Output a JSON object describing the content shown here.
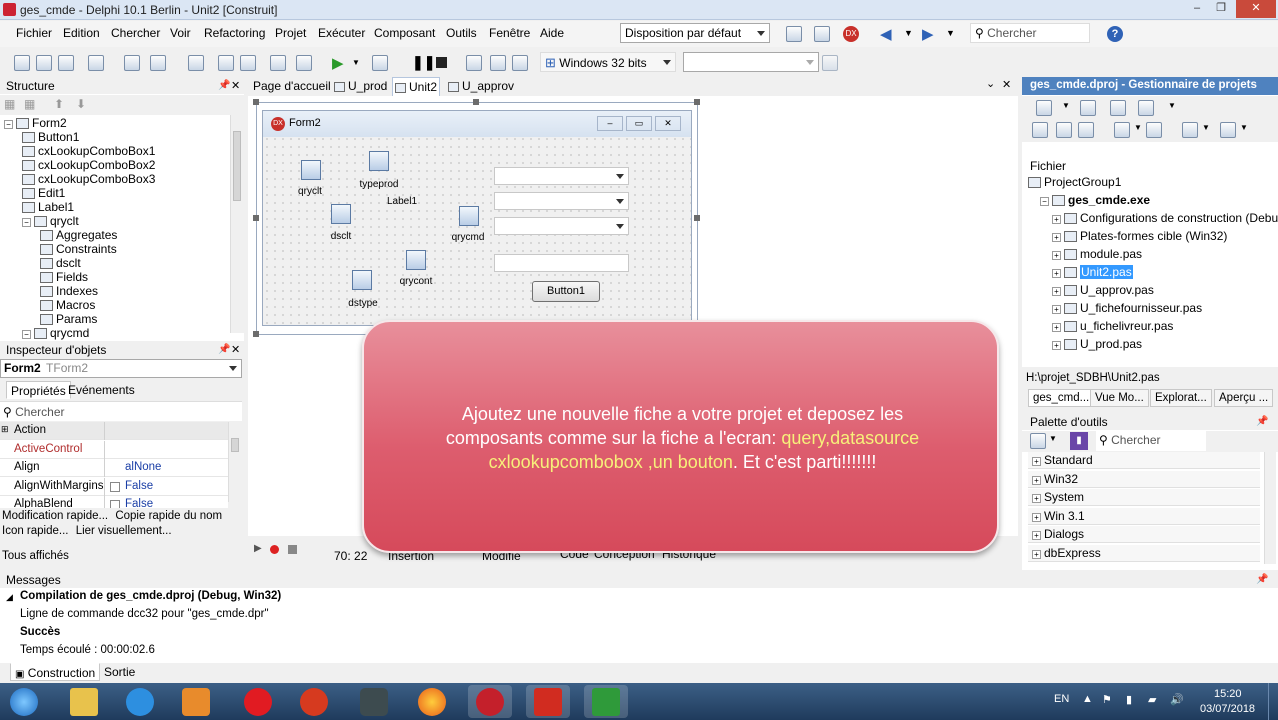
{
  "window": {
    "title": "ges_cmde - Delphi 10.1 Berlin - Unit2 [Construit]"
  },
  "menu": [
    "Fichier",
    "Edition",
    "Chercher",
    "Voir",
    "Refactoring",
    "Projet",
    "Exécuter",
    "Composant",
    "Outils",
    "Fenêtre",
    "Aide"
  ],
  "toolbar": {
    "layout_combo": "Disposition par défaut",
    "search_placeholder": "Chercher",
    "platform_combo": "Windows 32 bits",
    "config_combo": ""
  },
  "structure": {
    "title": "Structure",
    "items": [
      {
        "label": "Form2",
        "level": 0
      },
      {
        "label": "Button1",
        "level": 1
      },
      {
        "label": "cxLookupComboBox1",
        "level": 1
      },
      {
        "label": "cxLookupComboBox2",
        "level": 1
      },
      {
        "label": "cxLookupComboBox3",
        "level": 1
      },
      {
        "label": "Edit1",
        "level": 1
      },
      {
        "label": "Label1",
        "level": 1
      },
      {
        "label": "qryclt",
        "level": 1
      },
      {
        "label": "Aggregates",
        "level": 2
      },
      {
        "label": "Constraints",
        "level": 2
      },
      {
        "label": "dsclt",
        "level": 2
      },
      {
        "label": "Fields",
        "level": 2
      },
      {
        "label": "Indexes",
        "level": 2
      },
      {
        "label": "Macros",
        "level": 2
      },
      {
        "label": "Params",
        "level": 2
      },
      {
        "label": "qrycmd",
        "level": 1
      }
    ]
  },
  "inspector": {
    "title": "Inspecteur d'objets",
    "object": "Form2",
    "object_type": "TForm2",
    "tabs": [
      "Propriétés",
      "Evénements"
    ],
    "search_placeholder": "Chercher",
    "rows": [
      {
        "name": "Action",
        "value": ""
      },
      {
        "name": "ActiveControl",
        "value": ""
      },
      {
        "name": "Align",
        "value": "alNone"
      },
      {
        "name": "AlignWithMargins",
        "value": "False"
      },
      {
        "name": "AlphaBlend",
        "value": "False"
      }
    ],
    "hints": [
      [
        "Modification rapide...",
        "Copie rapide du nom"
      ],
      [
        "Icon rapide...",
        "Lier visuellement..."
      ]
    ],
    "filter": "Tous affichés"
  },
  "editor": {
    "tabs": [
      "Page d'accueil",
      "U_prod",
      "Unit2",
      "U_approv"
    ],
    "active_tab": "Unit2",
    "form": {
      "caption": "Form2",
      "components": [
        "qryclt",
        "typeprod",
        "dsclt",
        "qrycmd",
        "qrycont",
        "dstype"
      ],
      "label": "Label1",
      "button": "Button1"
    },
    "status": {
      "position": "70: 22",
      "mode": "Insertion",
      "modified": "Modifié",
      "tabs": [
        "Code",
        "Conception",
        "Historique"
      ]
    }
  },
  "project": {
    "title": "ges_cmde.dproj - Gestionnaire de projets",
    "files_label": "Fichier",
    "tree": [
      {
        "label": "ProjectGroup1",
        "level": 0,
        "bold": false
      },
      {
        "label": "ges_cmde.exe",
        "level": 1,
        "bold": true
      },
      {
        "label": "Configurations de construction (Debug)",
        "level": 2,
        "bold": false
      },
      {
        "label": "Plates-formes cible (Win32)",
        "level": 2,
        "bold": false
      },
      {
        "label": "module.pas",
        "level": 2,
        "bold": false
      },
      {
        "label": "Unit2.pas",
        "level": 2,
        "bold": false,
        "selected": true
      },
      {
        "label": "U_approv.pas",
        "level": 2,
        "bold": false
      },
      {
        "label": "U_fichefournisseur.pas",
        "level": 2,
        "bold": false
      },
      {
        "label": "u_fichelivreur.pas",
        "level": 2,
        "bold": false
      },
      {
        "label": "U_prod.pas",
        "level": 2,
        "bold": false
      }
    ],
    "path": "H:\\projet_SDBH\\Unit2.pas",
    "tabs": [
      "ges_cmd...",
      "Vue Mo...",
      "Explorat...",
      "Aperçu ..."
    ]
  },
  "palette": {
    "title": "Palette d'outils",
    "search_placeholder": "Chercher",
    "groups": [
      "Standard",
      "Win32",
      "System",
      "Win 3.1",
      "Dialogs",
      "dbExpress"
    ]
  },
  "overlay": {
    "line1": "Ajoutez une nouvelle fiche a votre projet et deposez les",
    "line2_a": "composants comme sur la fiche a l'ecran: ",
    "line2_b": "query,datasource",
    "line3_a": "cxlookupcombobox ,un bouton",
    "line3_b": ". Et c'est parti!!!!!!!"
  },
  "messages": {
    "title": "Messages",
    "lines": [
      {
        "text": "Compilation de ges_cmde.dproj (Debug, Win32)",
        "bold": true
      },
      {
        "text": "Ligne de commande dcc32 pour \"ges_cmde.dpr\"",
        "bold": false
      },
      {
        "text": "Succès",
        "bold": true
      },
      {
        "text": "Temps écoulé : 00:00:02.6",
        "bold": false
      }
    ],
    "tabs": [
      "Construction",
      "Sortie"
    ]
  },
  "taskbar": {
    "lang": "EN",
    "time": "15:20",
    "date": "03/07/2018"
  },
  "colors": {
    "overlay": "#dd5d6e",
    "highlight": "#f7f07a",
    "taskbar": "#2a4a70",
    "selection": "#3399ff"
  }
}
